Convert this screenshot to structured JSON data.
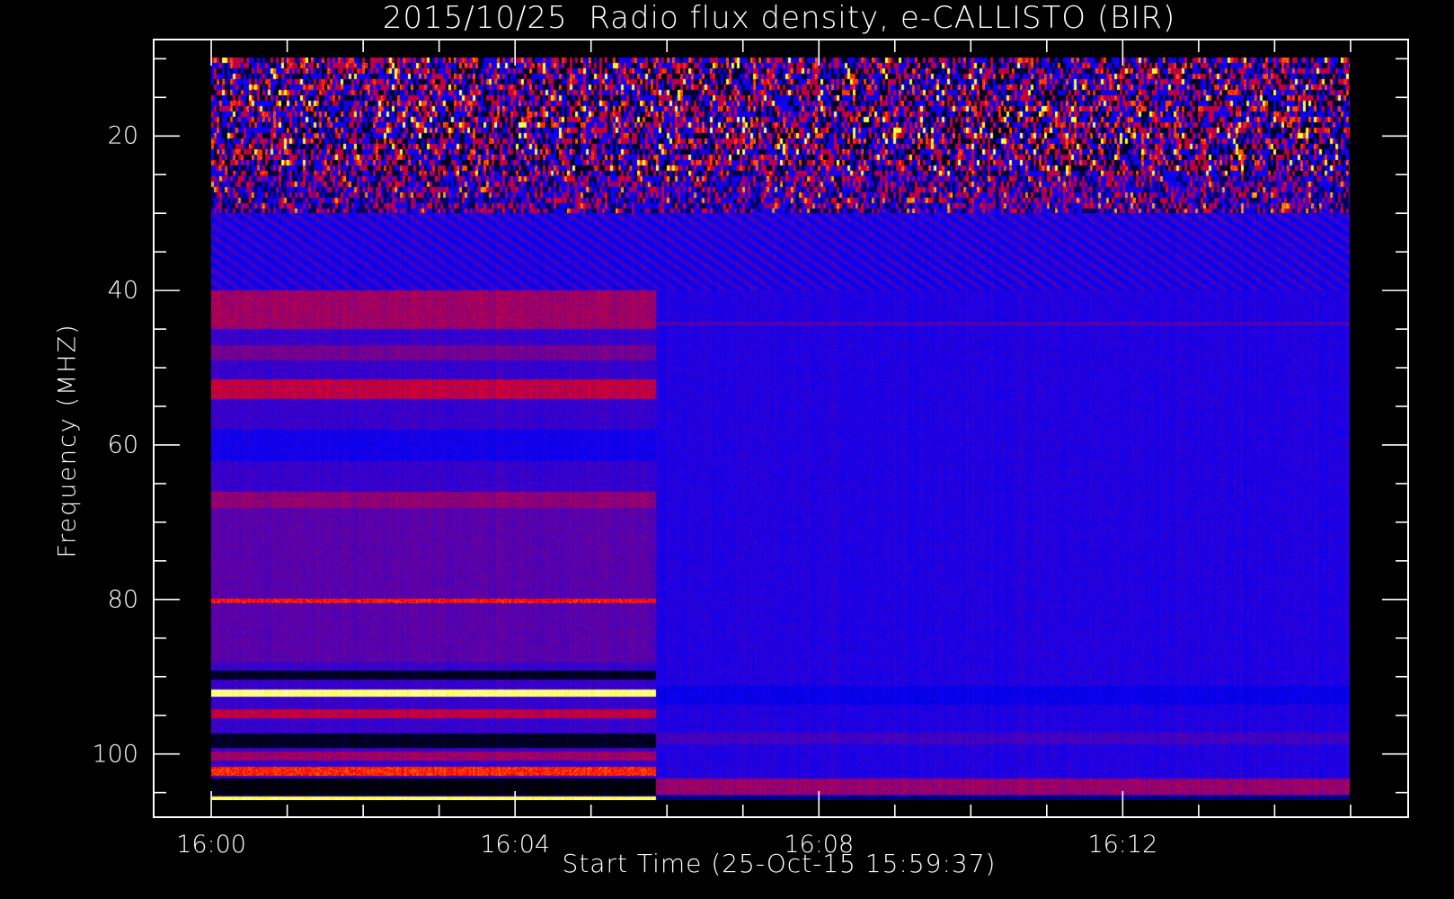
{
  "chart_data": {
    "type": "heatmap",
    "title": "2015/10/25  Radio flux density, e-CALLISTO (BIR)",
    "xlabel": "Start Time (25-Oct-15 15:59:37)",
    "ylabel": "Frequency (MHZ)",
    "x_unit": "minutes after 16:00",
    "xlim": [
      -0.77,
      15.77
    ],
    "data_x_range": [
      0,
      15
    ],
    "x_major_ticks": [
      0,
      4,
      8,
      12
    ],
    "x_tick_labels": [
      "16:00",
      "16:04",
      "16:08",
      "16:12"
    ],
    "x_minor_step": 1,
    "ylim": [
      108.3,
      7.4
    ],
    "data_y_range": [
      10,
      105.8
    ],
    "y_major_ticks": [
      20,
      40,
      60,
      80,
      100
    ],
    "y_tick_labels": [
      "20",
      "40",
      "60",
      "80",
      "100"
    ],
    "y_minor_step": 5,
    "colormap": [
      "#000000",
      "#0000ff",
      "#7a0080",
      "#ff0000",
      "#ffff00",
      "#ffffff"
    ],
    "rfi_band": {
      "freq": [
        10,
        30
      ],
      "description": "intense interference, mixed levels"
    },
    "segments": [
      {
        "time": [
          0,
          5.86
        ],
        "base_level": 0.4,
        "bands": [
          {
            "freq": [
              30,
              40
            ],
            "level": 0.36
          },
          {
            "freq": [
              40,
              45
            ],
            "level": 0.56
          },
          {
            "freq": [
              47,
              49
            ],
            "level": 0.5
          },
          {
            "freq": [
              51.5,
              54
            ],
            "level": 0.6
          },
          {
            "freq": [
              58,
              62
            ],
            "level": 0.33
          },
          {
            "freq": [
              66,
              68
            ],
            "level": 0.54
          },
          {
            "freq": [
              68,
              88
            ],
            "level": 0.46
          },
          {
            "freq": [
              79.8,
              80.3
            ],
            "level": 0.68
          },
          {
            "freq": [
              89,
              90.2
            ],
            "level": 0.04
          },
          {
            "freq": [
              91.5,
              92.4
            ],
            "level": 0.92
          },
          {
            "freq": [
              94,
              95.2
            ],
            "level": 0.6
          },
          {
            "freq": [
              97.2,
              99
            ],
            "level": 0.04
          },
          {
            "freq": [
              99.5,
              100.6
            ],
            "level": 0.56
          },
          {
            "freq": [
              101.5,
              102.6
            ],
            "level": 0.7
          },
          {
            "freq": [
              103,
              105.2
            ],
            "level": 0.0
          },
          {
            "freq": [
              105.3,
              105.8
            ],
            "level": 0.9
          }
        ]
      },
      {
        "time": [
          5.86,
          15
        ],
        "base_level": 0.36,
        "bands": [
          {
            "freq": [
              44,
              44.5
            ],
            "level": 0.45
          },
          {
            "freq": [
              91,
              93.5
            ],
            "level": 0.3
          },
          {
            "freq": [
              97,
              98.5
            ],
            "level": 0.42
          },
          {
            "freq": [
              103,
              105
            ],
            "level": 0.55
          },
          {
            "freq": [
              105.2,
              105.8
            ],
            "level": 0.15
          }
        ]
      }
    ]
  }
}
